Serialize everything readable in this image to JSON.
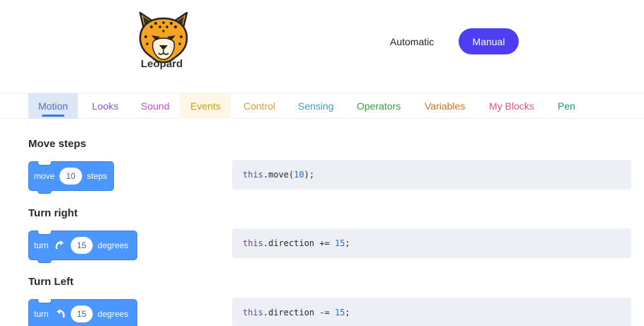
{
  "header": {
    "logo_text": "Leopard",
    "modes": {
      "automatic": "Automatic",
      "manual": "Manual"
    }
  },
  "tabs": [
    {
      "label": "Motion",
      "color": "#4c6ec8",
      "active": true
    },
    {
      "label": "Looks",
      "color": "#8a55d7"
    },
    {
      "label": "Sound",
      "color": "#c94fd1"
    },
    {
      "label": "Events",
      "color": "#c8a013"
    },
    {
      "label": "Control",
      "color": "#e59b1b"
    },
    {
      "label": "Sensing",
      "color": "#3e9fc5"
    },
    {
      "label": "Operators",
      "color": "#3f9a45"
    },
    {
      "label": "Variables",
      "color": "#dc6f1d"
    },
    {
      "label": "My Blocks",
      "color": "#f0507a"
    },
    {
      "label": "Pen",
      "color": "#12a36a"
    }
  ],
  "sections": [
    {
      "title": "Move steps",
      "block": {
        "pre": "move",
        "value": "10",
        "post": "steps"
      },
      "code": {
        "this": "this",
        "rest": ".move(",
        "num": "10",
        "end": ");"
      }
    },
    {
      "title": "Turn right",
      "block": {
        "pre": "turn",
        "icon": "rotate-right-icon",
        "value": "15",
        "post": "degrees"
      },
      "code": {
        "this": "this",
        "rest": ".direction += ",
        "num": "15",
        "end": ";"
      }
    },
    {
      "title": "Turn Left",
      "block": {
        "pre": "turn",
        "icon": "rotate-left-icon",
        "value": "15",
        "post": "degrees"
      },
      "code": {
        "this": "this",
        "rest": ".direction -= ",
        "num": "15",
        "end": ";"
      }
    }
  ]
}
